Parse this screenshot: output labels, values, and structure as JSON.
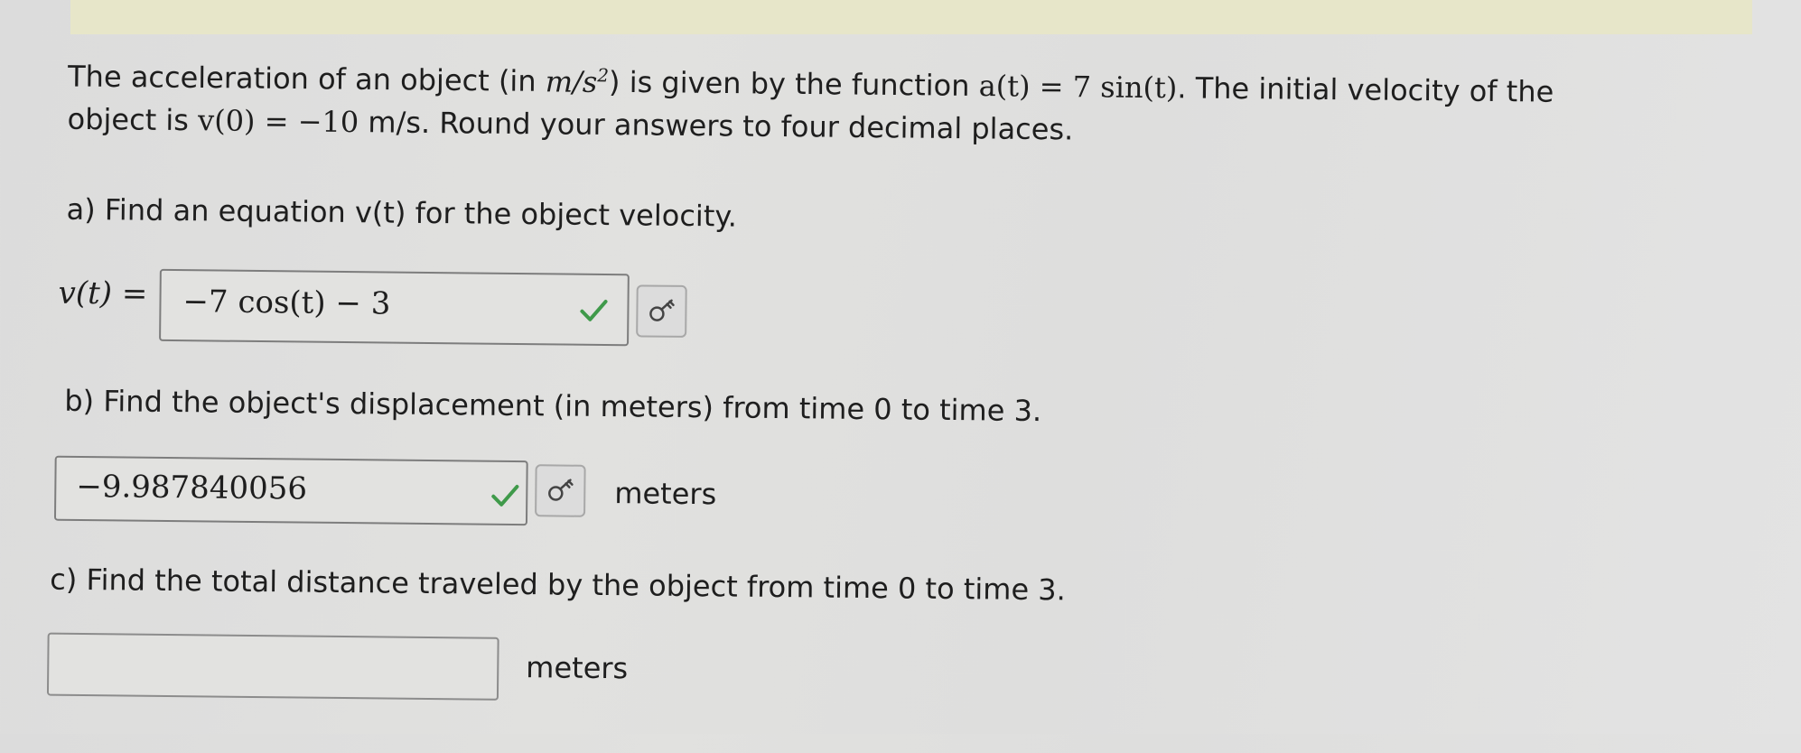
{
  "question": {
    "intro_line1_prefix": "The acceleration of an object (in ",
    "accel_unit_base": "m/s",
    "accel_unit_exp": "2",
    "intro_line1_mid": ") is given by the function ",
    "accel_function": "a(t) = 7 sin(t)",
    "intro_line1_suffix": ". The initial velocity of the",
    "intro_line2_prefix": "object is ",
    "initial_velocity": "v(0) = −10",
    "intro_line2_suffix": " m/s. Round your answers to four decimal places."
  },
  "part_a": {
    "prompt": "a) Find an equation v(t) for the object velocity.",
    "label": "v(t) =",
    "answer": "−7 cos(t) − 3",
    "status": "correct"
  },
  "part_b": {
    "prompt": "b) Find the object's displacement (in meters) from time 0 to time 3.",
    "answer": "−9.987840056",
    "unit": "meters",
    "status": "correct"
  },
  "part_c": {
    "prompt": "c) Find the total distance traveled by the object from time 0 to time 3.",
    "answer": "",
    "unit": "meters"
  },
  "icons": {
    "correct": "check-icon",
    "key": "key-icon"
  },
  "colors": {
    "check": "#3f9a4a",
    "top_bar": "#e7e6c9"
  }
}
